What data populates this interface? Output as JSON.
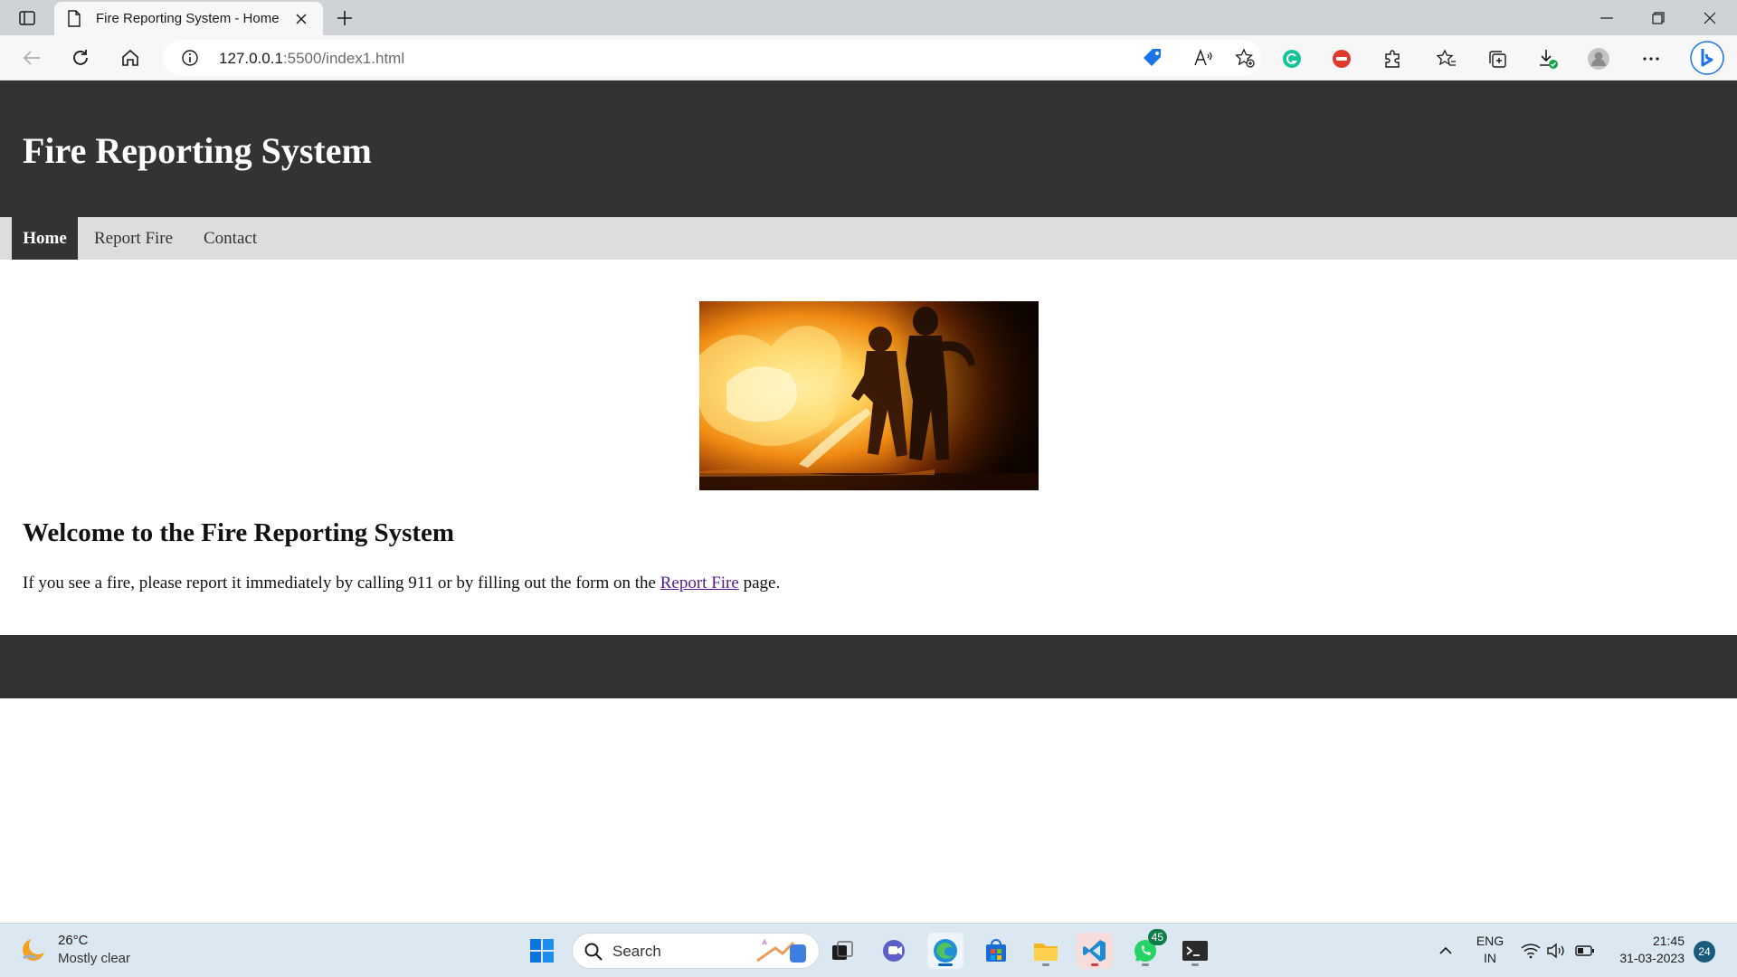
{
  "browser": {
    "tab_title": "Fire Reporting System - Home",
    "url_host": "127.0.0.1",
    "url_rest": ":5500/index1.html"
  },
  "site": {
    "title": "Fire Reporting System",
    "nav": [
      "Home",
      "Report Fire",
      "Contact"
    ],
    "hero_alt": "firefighters-icon",
    "heading": "Welcome to the Fire Reporting System",
    "para_before": "If you see a fire, please report it immediately by calling 911 or by filling out the form on the ",
    "para_link": "Report Fire",
    "para_after": " page."
  },
  "taskbar": {
    "weather_temp": "26°C",
    "weather_desc": "Mostly clear",
    "search_label": "Search",
    "whatsapp_badge": "45",
    "lang_line1": "ENG",
    "lang_line2": "IN",
    "time": "21:45",
    "date": "31-03-2023",
    "notifications": "24"
  },
  "colors": {
    "header_bg": "#333333",
    "nav_bg": "#dddddd",
    "link_visited": "#551a8b"
  }
}
